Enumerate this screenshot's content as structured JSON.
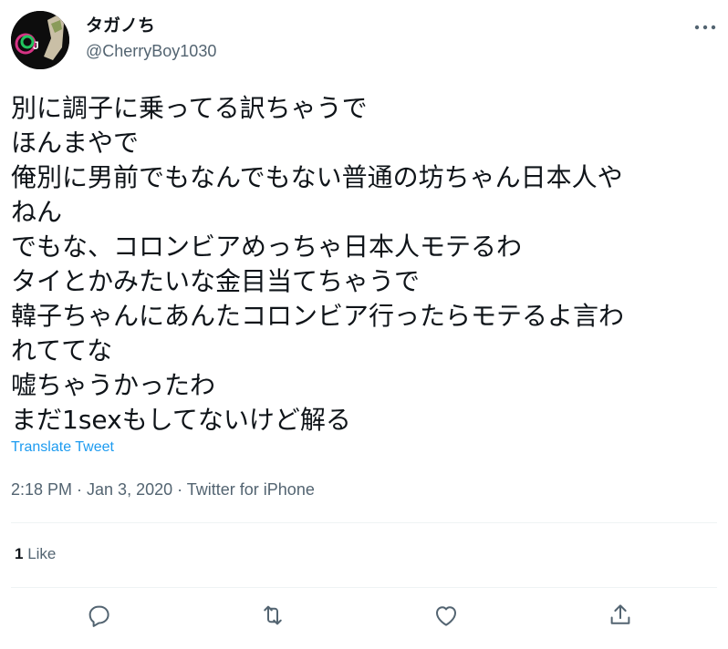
{
  "user": {
    "display_name": "タガノち",
    "handle": "@CherryBoy1030"
  },
  "tweet": {
    "text": "別に調子に乗ってる訳ちゃうで\nほんまやで\n俺別に男前でもなんでもない普通の坊ちゃん日本人や\nねん\nでもな、コロンビアめっちゃ日本人モテるわ\nタイとかみたいな金目当てちゃうで\n韓子ちゃんにあんたコロンビア行ったらモテるよ言わ\nれててな\n嘘ちゃうかったわ\nまだ1sexもしてないけど解る",
    "translate_label": "Translate Tweet",
    "timestamp": "2:18 PM · Jan 3, 2020 · Twitter for iPhone"
  },
  "stats": {
    "like_count": "1",
    "like_label": "Like"
  },
  "icons": {
    "more": "more-horizontal-icon",
    "reply": "reply-icon",
    "retweet": "retweet-icon",
    "like": "heart-icon",
    "share": "share-icon"
  },
  "colors": {
    "link": "#1d9bf0",
    "secondary_text": "#536471",
    "divider": "#eff3f4"
  }
}
